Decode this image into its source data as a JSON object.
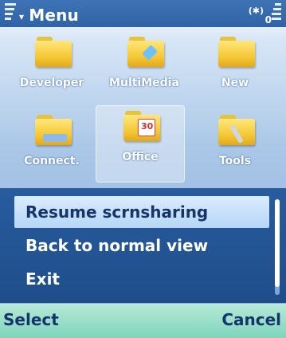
{
  "statusbar": {
    "title": "Menu",
    "indicator": "(✱)",
    "indicator_right": "0"
  },
  "apps": [
    {
      "label": "Developer",
      "icon": "folder-icon"
    },
    {
      "label": "MultiMedia",
      "icon": "multimedia-folder-icon"
    },
    {
      "label": "New",
      "icon": "folder-icon"
    },
    {
      "label": "Connect.",
      "icon": "connectivity-folder-icon"
    },
    {
      "label": "Office",
      "icon": "office-folder-icon",
      "badge": "30",
      "selected": true
    },
    {
      "label": "Tools",
      "icon": "tools-folder-icon"
    }
  ],
  "options_menu": {
    "items": [
      {
        "label": "Resume scrnsharing",
        "highlighted": true
      },
      {
        "label": "Back to normal view"
      },
      {
        "label": "Exit"
      }
    ]
  },
  "softkeys": {
    "left": "Select",
    "right": "Cancel"
  },
  "colors": {
    "title_bar": "#2f63a6",
    "popup_bg": "#1f4d8a",
    "highlight": "#d9ecff",
    "softkey_bg": "#7fd4bc",
    "softkey_text": "#14346a"
  }
}
